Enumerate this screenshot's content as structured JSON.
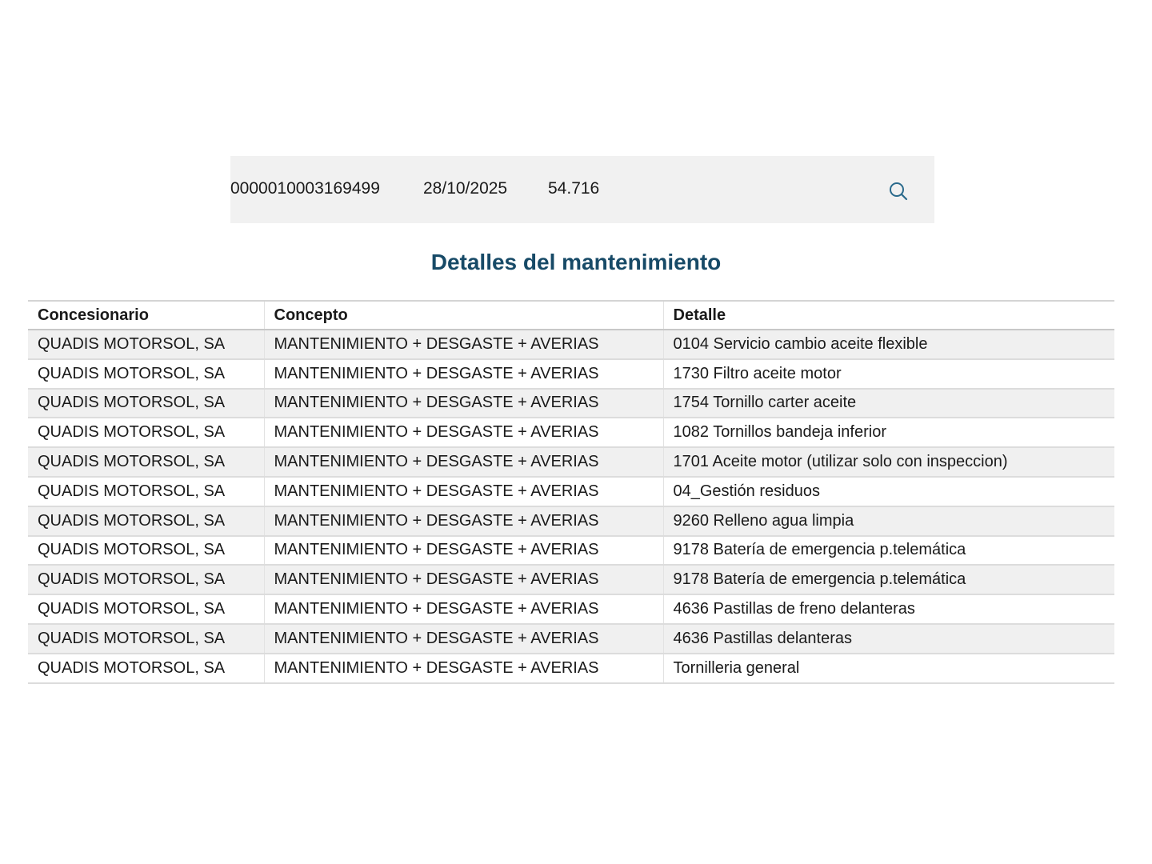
{
  "summary": {
    "reference": "0000010003169499",
    "date": "28/10/2025",
    "mileage": "54.716",
    "search_icon": "search-icon"
  },
  "title": "Detalles del mantenimiento",
  "table": {
    "headers": [
      "Concesionario",
      "Concepto",
      "Detalle"
    ],
    "rows": [
      [
        "QUADIS MOTORSOL, SA",
        "MANTENIMIENTO + DESGASTE + AVERIAS",
        "0104 Servicio cambio aceite flexible"
      ],
      [
        "QUADIS MOTORSOL, SA",
        "MANTENIMIENTO + DESGASTE + AVERIAS",
        "1730 Filtro aceite motor"
      ],
      [
        "QUADIS MOTORSOL, SA",
        "MANTENIMIENTO + DESGASTE + AVERIAS",
        "1754 Tornillo carter aceite"
      ],
      [
        "QUADIS MOTORSOL, SA",
        "MANTENIMIENTO + DESGASTE + AVERIAS",
        "1082 Tornillos bandeja inferior"
      ],
      [
        "QUADIS MOTORSOL, SA",
        "MANTENIMIENTO + DESGASTE + AVERIAS",
        "1701 Aceite motor (utilizar solo con inspeccion)"
      ],
      [
        "QUADIS MOTORSOL, SA",
        "MANTENIMIENTO + DESGASTE + AVERIAS",
        "04_Gestión residuos"
      ],
      [
        "QUADIS MOTORSOL, SA",
        "MANTENIMIENTO + DESGASTE + AVERIAS",
        "9260 Relleno agua limpia"
      ],
      [
        "QUADIS MOTORSOL, SA",
        "MANTENIMIENTO + DESGASTE + AVERIAS",
        "9178 Batería de emergencia p.telemática"
      ],
      [
        "QUADIS MOTORSOL, SA",
        "MANTENIMIENTO + DESGASTE + AVERIAS",
        "9178 Batería de emergencia p.telemática"
      ],
      [
        "QUADIS MOTORSOL, SA",
        "MANTENIMIENTO + DESGASTE + AVERIAS",
        "4636 Pastillas de freno delanteras"
      ],
      [
        "QUADIS MOTORSOL, SA",
        "MANTENIMIENTO + DESGASTE + AVERIAS",
        "4636 Pastillas delanteras"
      ],
      [
        "QUADIS MOTORSOL, SA",
        "MANTENIMIENTO + DESGASTE + AVERIAS",
        "Tornilleria general"
      ]
    ]
  },
  "colors": {
    "title": "#174a67",
    "icon": "#2a6a8c",
    "row_alt": "#f0f0f0",
    "bar_bg": "#f1f1f1"
  }
}
